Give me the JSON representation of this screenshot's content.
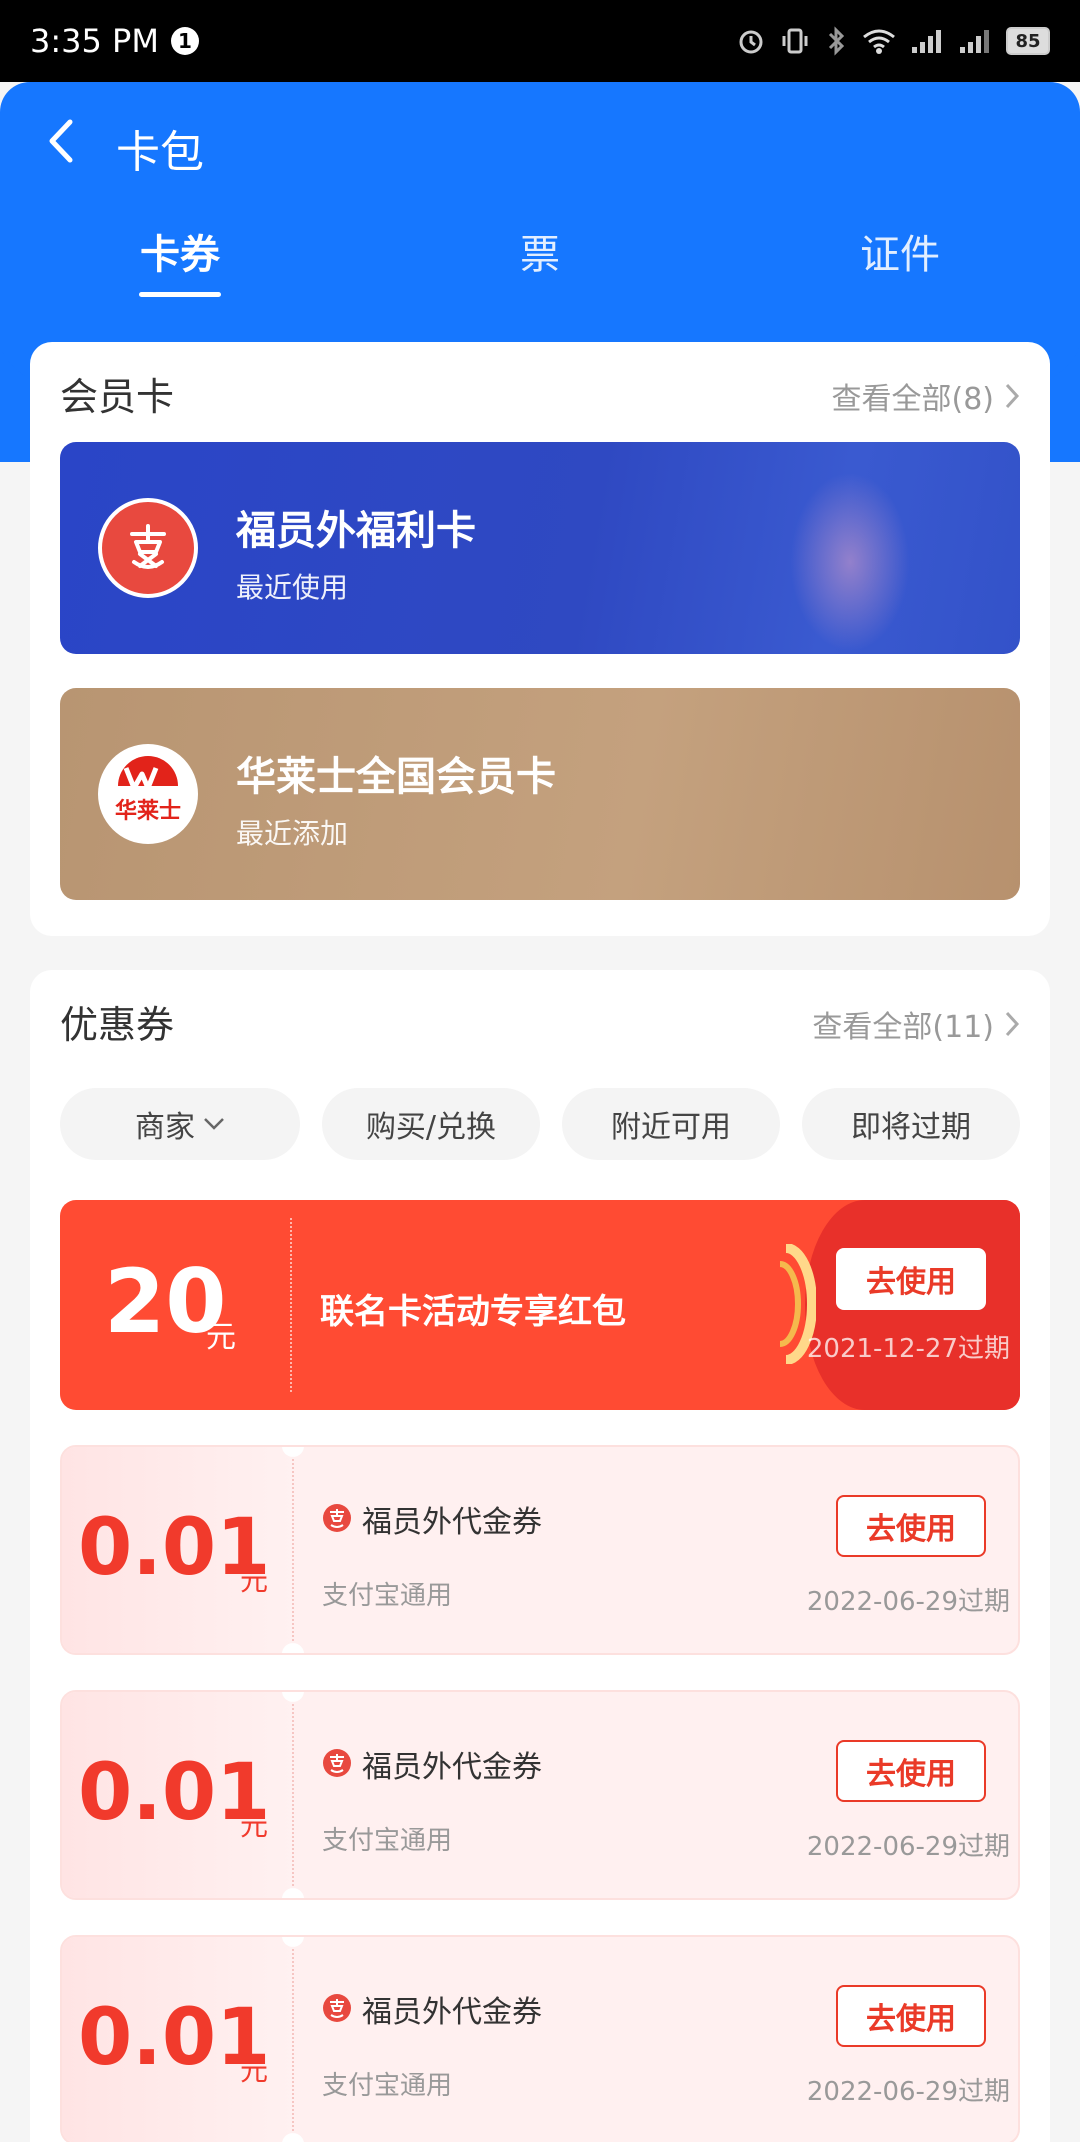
{
  "status_bar": {
    "time": "3:35 PM",
    "notification_badge": "1",
    "battery": "85",
    "icons": [
      "alarm-icon",
      "vibrate-icon",
      "bluetooth-icon",
      "wifi-icon",
      "signal-icon",
      "signal-icon-2",
      "battery-icon"
    ]
  },
  "nav": {
    "title": "卡包",
    "back_icon": "back-arrow-icon"
  },
  "tabs": [
    {
      "label": "卡券",
      "active": true
    },
    {
      "label": "票",
      "active": false
    },
    {
      "label": "证件",
      "active": false
    }
  ],
  "membership": {
    "title": "会员卡",
    "view_all": "查看全部(8)",
    "cards": [
      {
        "name": "福员外福利卡",
        "sub": "最近使用",
        "color": "#2b46c9"
      },
      {
        "name": "华莱士全国会员卡",
        "sub": "最近添加",
        "color": "#bf9b78",
        "logo_text": "华莱士"
      }
    ]
  },
  "coupons": {
    "title": "优惠券",
    "view_all": "查看全部(11)",
    "filters": [
      {
        "label": "商家",
        "dropdown": true
      },
      {
        "label": "购买/兑换",
        "dropdown": false
      },
      {
        "label": "附近可用",
        "dropdown": false
      },
      {
        "label": "即将过期",
        "dropdown": false
      }
    ],
    "featured": {
      "amount": "20",
      "unit": "元",
      "title": "联名卡活动专享红包",
      "button": "去使用",
      "expire": "2021-12-27过期"
    },
    "items": [
      {
        "amount": "0.01",
        "unit": "元",
        "title": "福员外代金券",
        "sub": "支付宝通用",
        "button": "去使用",
        "expire": "2022-06-29过期"
      },
      {
        "amount": "0.01",
        "unit": "元",
        "title": "福员外代金券",
        "sub": "支付宝通用",
        "button": "去使用",
        "expire": "2022-06-29过期"
      },
      {
        "amount": "0.01",
        "unit": "元",
        "title": "福员外代金券",
        "sub": "支付宝通用",
        "button": "去使用",
        "expire": "2022-06-29过期"
      }
    ]
  },
  "colors": {
    "primary_blue": "#1677ff",
    "coupon_red": "#ff4b33",
    "price_red": "#f13a2c"
  }
}
